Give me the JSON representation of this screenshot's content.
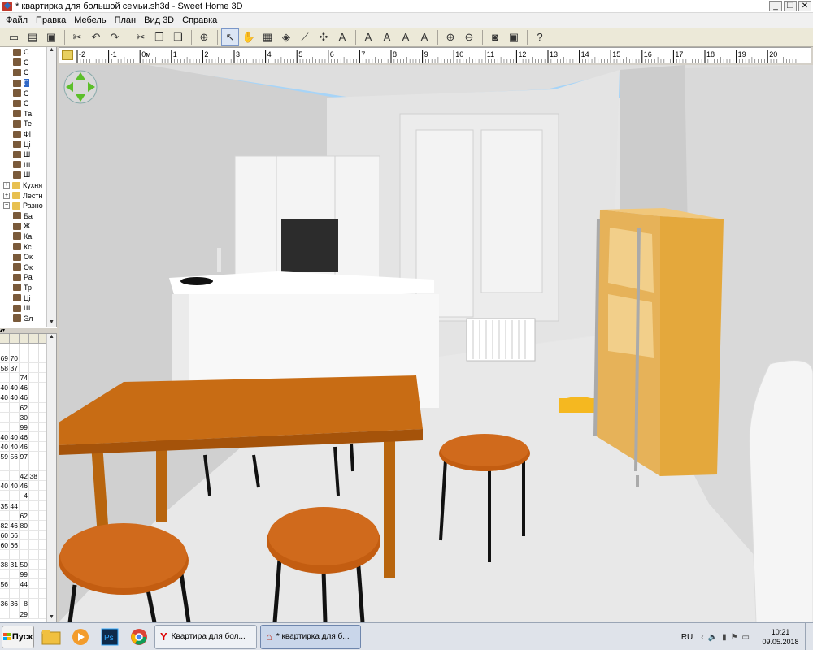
{
  "window": {
    "title": "* квартирка для большой семьи.sh3d - Sweet Home 3D"
  },
  "menu": [
    "Файл",
    "Правка",
    "Мебель",
    "План",
    "Вид 3D",
    "Справка"
  ],
  "toolbar": {
    "buttons": [
      {
        "name": "new-icon",
        "glyph": "▭"
      },
      {
        "name": "open-icon",
        "glyph": "▤"
      },
      {
        "name": "save-icon",
        "glyph": "▣"
      },
      {
        "sep": true
      },
      {
        "name": "cut-icon",
        "glyph": "✂"
      },
      {
        "name": "undo-icon",
        "glyph": "↶"
      },
      {
        "name": "redo-icon",
        "glyph": "↷"
      },
      {
        "sep": true
      },
      {
        "name": "cut-icon-2",
        "glyph": "✂"
      },
      {
        "name": "copy-icon",
        "glyph": "❐"
      },
      {
        "name": "paste-icon",
        "glyph": "❑"
      },
      {
        "sep": true
      },
      {
        "name": "add-furniture-icon",
        "glyph": "⊕"
      },
      {
        "sep": true
      },
      {
        "name": "select-mode-icon",
        "glyph": "↖",
        "active": true
      },
      {
        "name": "pan-mode-icon",
        "glyph": "✋"
      },
      {
        "name": "create-walls-icon",
        "glyph": "▦"
      },
      {
        "name": "create-rooms-icon",
        "glyph": "◈"
      },
      {
        "name": "create-polylines-icon",
        "glyph": "⟋"
      },
      {
        "name": "create-dimensions-icon",
        "glyph": "✣"
      },
      {
        "name": "add-text-icon",
        "glyph": "A"
      },
      {
        "sep": true
      },
      {
        "name": "text-style-icon",
        "glyph": "A"
      },
      {
        "name": "text-style-icon-2",
        "glyph": "A"
      },
      {
        "name": "bold-text-icon",
        "glyph": "A"
      },
      {
        "name": "italic-text-icon",
        "glyph": "A"
      },
      {
        "sep": true
      },
      {
        "name": "zoom-in-icon",
        "glyph": "⊕"
      },
      {
        "name": "zoom-out-icon",
        "glyph": "⊖"
      },
      {
        "sep": true
      },
      {
        "name": "create-photo-icon",
        "glyph": "◙"
      },
      {
        "name": "create-video-icon",
        "glyph": "▣"
      },
      {
        "sep": true
      },
      {
        "name": "help-icon",
        "glyph": "?"
      }
    ]
  },
  "catalog": {
    "items": [
      {
        "label": "С",
        "type": "item"
      },
      {
        "label": "С",
        "type": "item"
      },
      {
        "label": "С",
        "type": "item"
      },
      {
        "label": "С",
        "type": "item",
        "selected": true
      },
      {
        "label": "С",
        "type": "item"
      },
      {
        "label": "С",
        "type": "item"
      },
      {
        "label": "Та",
        "type": "item"
      },
      {
        "label": "Те",
        "type": "item"
      },
      {
        "label": "Фі",
        "type": "item"
      },
      {
        "label": "Ці",
        "type": "item"
      },
      {
        "label": "Ш",
        "type": "item"
      },
      {
        "label": "Ш",
        "type": "item"
      },
      {
        "label": "Ш",
        "type": "item"
      },
      {
        "label": "Кухня",
        "type": "folder",
        "expander": "+"
      },
      {
        "label": "Лестн",
        "type": "folder",
        "expander": "+"
      },
      {
        "label": "Разно",
        "type": "folder",
        "expander": "−"
      },
      {
        "label": "Ба",
        "type": "item"
      },
      {
        "label": "Ж",
        "type": "item"
      },
      {
        "label": "Ка",
        "type": "item"
      },
      {
        "label": "Кс",
        "type": "item"
      },
      {
        "label": "Ок",
        "type": "item"
      },
      {
        "label": "Ок",
        "type": "item"
      },
      {
        "label": "Ра",
        "type": "item"
      },
      {
        "label": "Тр",
        "type": "item"
      },
      {
        "label": "Ці",
        "type": "item"
      },
      {
        "label": "Ш",
        "type": "item"
      },
      {
        "label": "Эл",
        "type": "item"
      }
    ]
  },
  "furniture_table": {
    "rows": [
      [
        "",
        "",
        "",
        "",
        ""
      ],
      [
        "69",
        "70",
        "",
        "",
        ""
      ],
      [
        "58",
        "37",
        "",
        "",
        ""
      ],
      [
        "",
        "",
        "74",
        "",
        ""
      ],
      [
        "40",
        "40",
        "46",
        "",
        ""
      ],
      [
        "40",
        "40",
        "46",
        "",
        ""
      ],
      [
        "",
        "",
        "62",
        "",
        ""
      ],
      [
        "",
        "",
        "30",
        "",
        ""
      ],
      [
        "",
        "",
        "99",
        "",
        ""
      ],
      [
        "40",
        "40",
        "46",
        "",
        ""
      ],
      [
        "40",
        "40",
        "46",
        "",
        ""
      ],
      [
        "59",
        "56",
        "97",
        "",
        ""
      ],
      [
        "",
        "",
        "",
        "",
        ""
      ],
      [
        "",
        "",
        "42",
        "38",
        ""
      ],
      [
        "40",
        "40",
        "46",
        "",
        ""
      ],
      [
        "",
        "",
        "4",
        "",
        ""
      ],
      [
        "35",
        "44",
        "",
        "",
        ""
      ],
      [
        "",
        "",
        "62",
        "",
        ""
      ],
      [
        "82",
        "46",
        "80",
        "",
        ""
      ],
      [
        "60",
        "66",
        "",
        "",
        ""
      ],
      [
        "60",
        "66",
        "",
        "",
        ""
      ],
      [
        "",
        "",
        "",
        "",
        ""
      ],
      [
        "38",
        "31",
        "50",
        "",
        ""
      ],
      [
        "",
        "",
        "99",
        "",
        ""
      ],
      [
        "56",
        "",
        "44",
        "",
        ""
      ],
      [
        "",
        "",
        "",
        "",
        ""
      ],
      [
        "36",
        "36",
        "8",
        "",
        ""
      ],
      [
        "",
        "",
        "29",
        "",
        ""
      ]
    ]
  },
  "ruler": {
    "labels": [
      "-2",
      "-1",
      "0м",
      "1",
      "2",
      "3",
      "4",
      "5",
      "6",
      "7",
      "8",
      "9",
      "10",
      "11",
      "12",
      "13",
      "14",
      "15",
      "16",
      "17",
      "18",
      "19",
      "20"
    ]
  },
  "colors": {
    "table_top": "#c86c14",
    "table_legs": "#b8650e",
    "stool_seat": "#c35d11",
    "cabinet": "#e8b35a",
    "sky": "#a7d4f7"
  },
  "taskbar": {
    "start_label": "Пуск",
    "apps": [
      {
        "name": "explorer",
        "glyph": "📁"
      },
      {
        "name": "media-player",
        "glyph": "▶"
      },
      {
        "name": "photoshop",
        "glyph": "Ps"
      },
      {
        "name": "chrome",
        "glyph": "◉"
      }
    ],
    "windows": [
      {
        "label": "Квартира для бол...",
        "icon": "Y"
      },
      {
        "label": "* квартирка для б...",
        "icon": "⌂",
        "active": true
      }
    ],
    "lang": "RU",
    "time": "10:21",
    "date": "09.05.2018"
  }
}
